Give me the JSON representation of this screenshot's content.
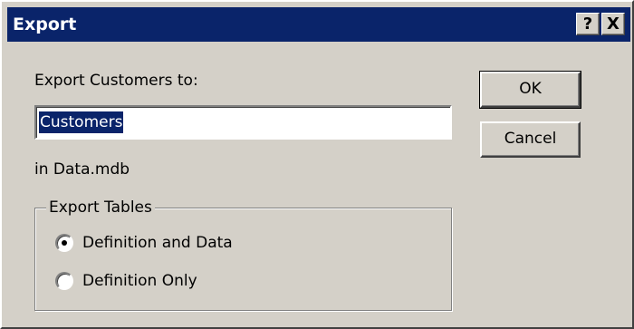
{
  "window": {
    "title": "Export",
    "help_button": "?",
    "close_button": "X"
  },
  "form": {
    "prompt_label": "Export Customers to:",
    "name_value": "Customers",
    "location_label": "in Data.mdb"
  },
  "export_tables": {
    "legend": "Export Tables",
    "options": [
      {
        "label": "Definition and Data",
        "selected": true
      },
      {
        "label": "Definition Only",
        "selected": false
      }
    ]
  },
  "buttons": {
    "ok_label": "OK",
    "cancel_label": "Cancel"
  },
  "colors": {
    "titlebar": "#0a246a",
    "dialog_face": "#d4d0c8",
    "selection": "#0a246a"
  }
}
